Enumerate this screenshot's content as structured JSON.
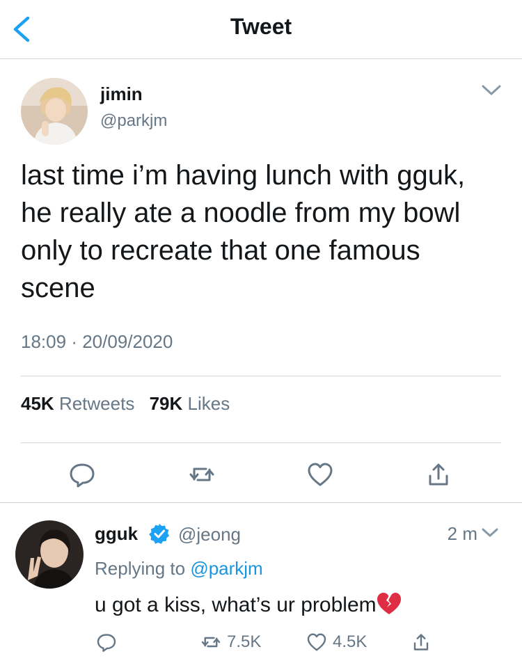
{
  "nav": {
    "title": "Tweet"
  },
  "tweet": {
    "author_name": "jimin",
    "author_handle": "@parkjm",
    "text": "last time i’m having lunch with gguk, he really ate a noodle from my bowl only to recreate that one famous scene",
    "time": "18:09",
    "separator": "·",
    "date": "20/09/2020",
    "retweet_count": "45K",
    "retweet_label": "Retweets",
    "like_count": "79K",
    "like_label": "Likes"
  },
  "reply": {
    "author_name": "gguk",
    "author_handle": "@jeong",
    "time_ago": "2 m",
    "replying_to_label": "Replying to",
    "replying_to_handle": "@parkjm",
    "text": "u got a kiss, what’s ur problem",
    "emoji": "broken-heart-icon",
    "retweet_count": "7.5K",
    "like_count": "4.5K"
  },
  "colors": {
    "accent": "#1da1f2",
    "text": "#14171a",
    "secondary": "#657786",
    "verified": "#1da1f2",
    "broken_heart": "#e0245e"
  }
}
